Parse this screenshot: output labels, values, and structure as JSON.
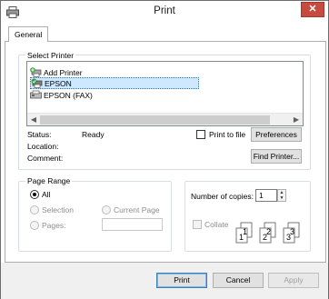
{
  "window": {
    "title": "Print",
    "close_glyph": "✕"
  },
  "tabs": [
    {
      "label": "General"
    }
  ],
  "select_printer": {
    "legend": "Select Printer",
    "printers": [
      {
        "name": "Add Printer",
        "icon": "add-printer-icon"
      },
      {
        "name": "EPSON",
        "icon": "printer-default-icon",
        "selected": true
      },
      {
        "name": "EPSON (FAX)",
        "icon": "fax-icon"
      }
    ],
    "status_label": "Status:",
    "status_value": "Ready",
    "location_label": "Location:",
    "comment_label": "Comment:",
    "print_to_file": "Print to file",
    "preferences": "Preferences",
    "find_printer": "Find Printer..."
  },
  "page_range": {
    "legend": "Page Range",
    "all": "All",
    "selection": "Selection",
    "current_page": "Current Page",
    "pages": "Pages:",
    "selected_option": "All"
  },
  "copies": {
    "label": "Number of copies:",
    "value": "1",
    "collate": "Collate",
    "collate_pages": [
      "1",
      "1",
      "2",
      "2",
      "3",
      "3"
    ]
  },
  "buttons": {
    "print": "Print",
    "cancel": "Cancel",
    "apply": "Apply"
  },
  "colors": {
    "close_button": "#c74a3f",
    "selection_highlight": "#cde8ff"
  }
}
